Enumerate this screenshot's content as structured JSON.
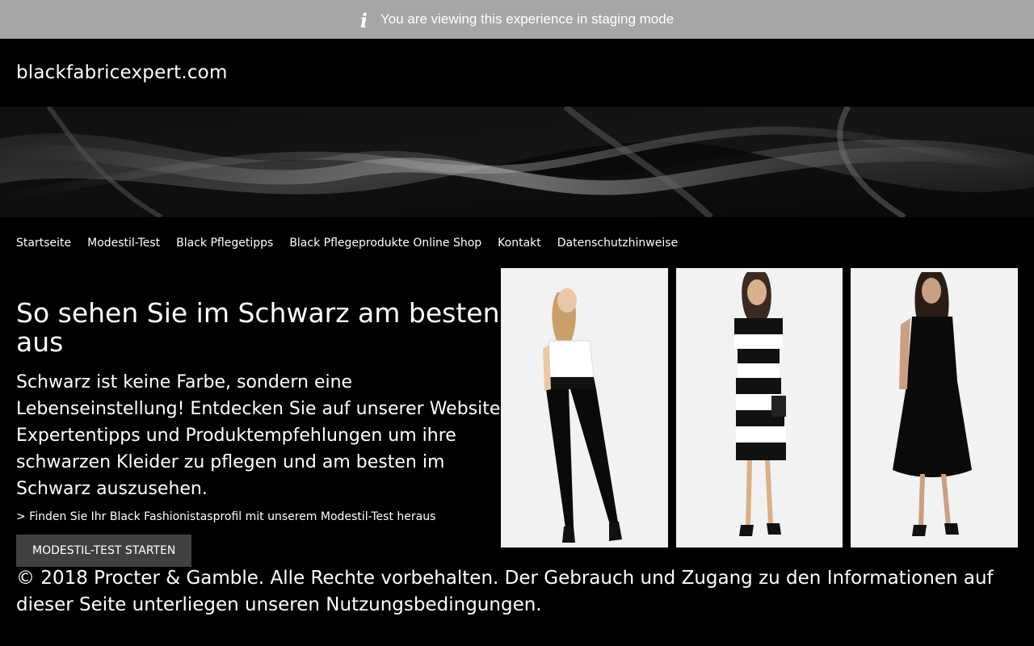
{
  "staging_bar": {
    "message": "You are viewing this experience in staging mode",
    "icon": "info-icon"
  },
  "header": {
    "logo_text": "blackfabricexpert.com"
  },
  "banner": {
    "description_icon": "black-satin-banner"
  },
  "nav": {
    "items": [
      {
        "label": "Startseite"
      },
      {
        "label": "Modestil-Test"
      },
      {
        "label": "Black Pflegetipps"
      },
      {
        "label": "Black Pflegeprodukte Online Shop"
      },
      {
        "label": "Kontakt"
      },
      {
        "label": "Datenschutzhinweise"
      }
    ]
  },
  "hero": {
    "headline": "So sehen Sie im Schwarz am besten aus",
    "lead": "Schwarz ist keine Farbe, sondern eine Lebenseinstellung! Entdecken Sie auf unserer Website Expertentipps und Produktempfehlungen um ihre schwarzen Kleider zu pflegen und am besten im Schwarz auszusehen.",
    "teaser": "> Finden Sie Ihr Black Fashionistasprofil mit unserem Modestil-Test heraus",
    "cta_label": "MODESTIL-TEST STARTEN"
  },
  "gallery": {
    "photos": [
      "model-black-jeans-photo",
      "model-striped-dress-photo",
      "model-black-dress-photo"
    ]
  },
  "footer": {
    "text": "© 2018 Procter & Gamble. Alle Rechte vorbehalten. Der Gebrauch und Zugang zu den Informationen auf dieser Seite unterliegen unseren Nutzungsbedingungen."
  },
  "colors": {
    "background": "#000000",
    "staging_bar": "#a7a7a7",
    "cta_background": "#404040",
    "text": "#ffffff"
  }
}
